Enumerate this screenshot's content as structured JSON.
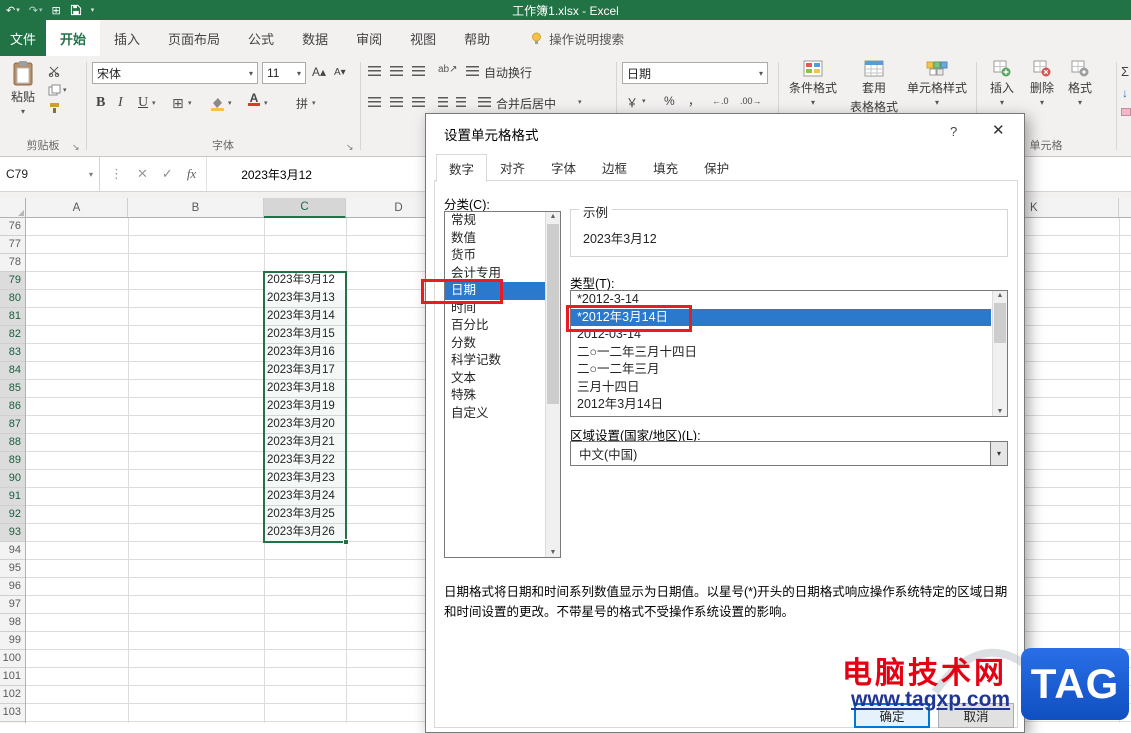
{
  "app": {
    "title": "工作簿1.xlsx  -  Excel"
  },
  "ribbon_tabs": {
    "file": "文件",
    "items": [
      "开始",
      "插入",
      "页面布局",
      "公式",
      "数据",
      "审阅",
      "视图",
      "帮助"
    ],
    "search_label": "操作说明搜索"
  },
  "ribbon": {
    "clipboard": {
      "paste_label": "粘贴",
      "group_label": "剪贴板"
    },
    "font": {
      "font_name": "宋体",
      "font_size": "11",
      "bold": "B",
      "italic": "I",
      "underline": "U",
      "phonetic": "拼",
      "group_label": "字体"
    },
    "alignment": {
      "wrap_label": "自动换行",
      "merge_label": "合并后居中"
    },
    "number": {
      "format_value": "日期"
    },
    "styles": {
      "conditional_label": "条件格式",
      "table_label_line1": "套用",
      "table_label_line2": "表格格式",
      "cell_styles_label": "单元格样式"
    },
    "cells": {
      "insert_label": "插入",
      "delete_label": "删除",
      "format_label": "格式",
      "group_label": "单元格"
    }
  },
  "formula_bar": {
    "name_box": "C79",
    "value": "2023年3月12"
  },
  "sheet": {
    "column_headers": [
      "A",
      "B",
      "C",
      "D"
    ],
    "right_column_header": "K",
    "selected_column": "C",
    "first_row": 76,
    "row_count": 29,
    "selection_start_row": 79,
    "selection_end_row": 93,
    "cell_values": [
      "2023年3月12",
      "2023年3月13",
      "2023年3月14",
      "2023年3月15",
      "2023年3月16",
      "2023年3月17",
      "2023年3月18",
      "2023年3月19",
      "2023年3月20",
      "2023年3月21",
      "2023年3月22",
      "2023年3月23",
      "2023年3月24",
      "2023年3月25",
      "2023年3月26"
    ]
  },
  "dialog": {
    "title": "设置单元格格式",
    "tabs": [
      "数字",
      "对齐",
      "字体",
      "边框",
      "填充",
      "保护"
    ],
    "active_tab": "数字",
    "category_label": "分类(C):",
    "categories": [
      "常规",
      "数值",
      "货币",
      "会计专用",
      "日期",
      "时间",
      "百分比",
      "分数",
      "科学记数",
      "文本",
      "特殊",
      "自定义"
    ],
    "selected_category": "日期",
    "sample_group_label": "示例",
    "sample_value": "2023年3月12",
    "type_label": "类型(T):",
    "types": [
      "*2012-3-14",
      "*2012年3月14日",
      "2012-03-14",
      "二○一二年三月十四日",
      "二○一二年三月",
      "三月十四日",
      "2012年3月14日"
    ],
    "selected_type": "*2012年3月14日",
    "locale_label": "区域设置(国家/地区)(L):",
    "locale_value": "中文(中国)",
    "description": "日期格式将日期和时间系列数值显示为日期值。以星号(*)开头的日期格式响应操作系统特定的区域日期和时间设置的更改。不带星号的格式不受操作系统设置的影响。",
    "ok_label": "确定",
    "cancel_label": "取消"
  },
  "watermark": {
    "site_name": "电脑技术网",
    "site_url": "www.tagxp.com",
    "logo_text": "TAG"
  },
  "icons": {
    "dropdown": "▾",
    "undo": "↶",
    "redo": "↷",
    "preview_grid": "⊞",
    "borders": "⊞",
    "kebab": "⋮",
    "cancel_x": "✕",
    "confirm_check": "✓",
    "fx": "fx",
    "launcher": "↘",
    "scroll_up": "▲",
    "scroll_down": "▼",
    "sigma": "Σ",
    "fill_down": "↓",
    "accounting": "￥",
    "percent": "%",
    "comma": "，",
    "increase_decimal": "←.0",
    "decrease_decimal": ".00→",
    "grow_font": "A▴",
    "shrink_font": "A▾",
    "orientation": "ab↗",
    "help": "?",
    "close": "✕",
    "select_all": "◢"
  },
  "colors": {
    "excel_green": "#217346",
    "selection_blue": "#2b79cd",
    "annotation_red": "#ea1b22",
    "watermark_red": "#e60013",
    "watermark_blue": "#1f3696",
    "logo_blue": "#1256c4"
  }
}
